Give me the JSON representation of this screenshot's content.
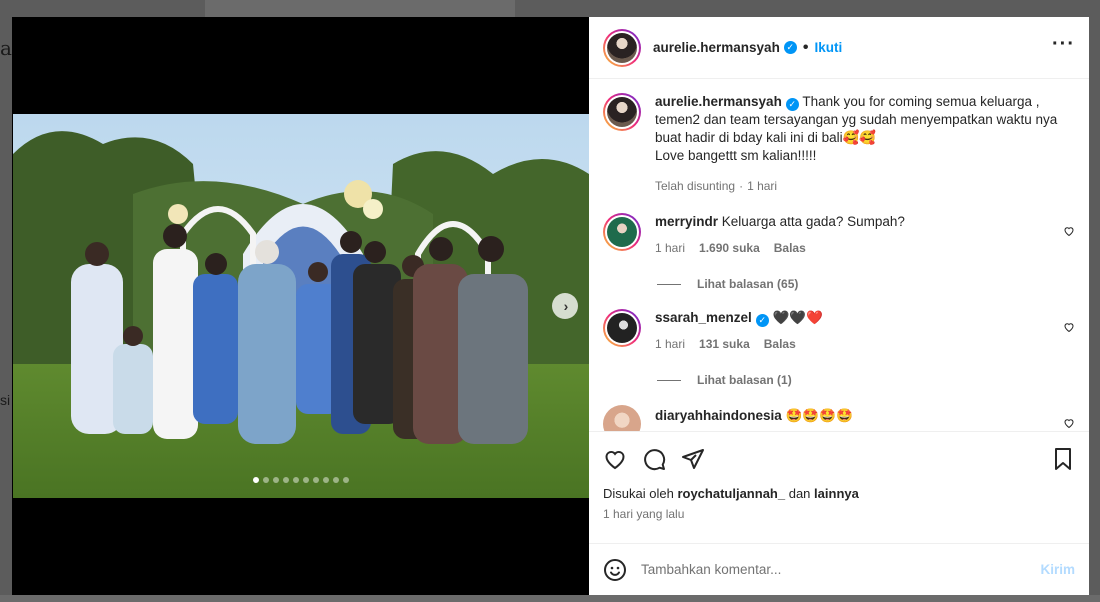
{
  "post": {
    "username": "aurelie.hermansyah",
    "follow_label": "Ikuti",
    "separator": "•",
    "more_label": "···",
    "carousel": {
      "slide_count": 10,
      "active_index": 0,
      "next_glyph": "›"
    }
  },
  "caption": {
    "username": "aurelie.hermansyah",
    "text": "Thank you for coming semua keluarga , temen2 dan team tersayangan yg sudah menyempatkan waktu nya buat hadir di bday kali ini di bali🥰🥰",
    "text_line2": "Love bangettt sm kalian!!!!!",
    "edited": "Telah disunting",
    "dot": "·",
    "time": "1 hari"
  },
  "comments": [
    {
      "username": "merryindr",
      "text": "Keluarga atta gada? Sumpah?",
      "time": "1 hari",
      "likes": "1.690 suka",
      "reply_label": "Balas",
      "view_replies": "Lihat balasan (65)",
      "avatar_color": "#1f6b4c"
    },
    {
      "username": "ssarah_menzel",
      "text": "🖤🖤❤️",
      "time": "1 hari",
      "likes": "131 suka",
      "reply_label": "Balas",
      "view_replies": "Lihat balasan (1)",
      "avatar_color": "#222222"
    },
    {
      "username": "diaryahhaindonesia",
      "text": "🤩🤩🤩🤩",
      "avatar_color": "#d8a58b"
    }
  ],
  "engagement": {
    "liked_prefix": "Disukai oleh",
    "liked_user": "roychatuljannah_",
    "liked_and": "dan",
    "liked_others": "lainnya",
    "time": "1 hari yang lalu"
  },
  "composer": {
    "placeholder": "Tambahkan komentar...",
    "send_label": "Kirim"
  },
  "colors": {
    "accent": "#0095f6",
    "send_disabled": "#b3dbff",
    "muted": "#737373"
  },
  "icons": [
    "heart-icon",
    "comment-icon",
    "share-icon",
    "bookmark-icon",
    "emoji-icon",
    "verified-icon",
    "chevron-right-icon"
  ]
}
